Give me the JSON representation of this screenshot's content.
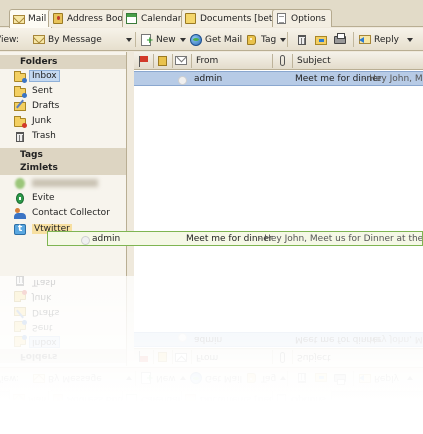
{
  "tabs": [
    {
      "label": "Mail",
      "icon": "envelope-icon",
      "active": true
    },
    {
      "label": "Address Book",
      "icon": "address-book-icon"
    },
    {
      "label": "Calendar",
      "icon": "calendar-icon"
    },
    {
      "label": "Documents [beta]",
      "icon": "documents-icon"
    },
    {
      "label": "Options",
      "icon": "options-icon"
    }
  ],
  "toolbar": {
    "view_label": "View:",
    "view_value": "By Message",
    "new_label": "New",
    "get_mail_label": "Get Mail",
    "tag_label": "Tag",
    "reply_label": "Reply"
  },
  "tree": {
    "folders_header": "Folders",
    "folders": [
      {
        "label": "Inbox",
        "icon": "inbox-icon",
        "selected": true
      },
      {
        "label": "Sent",
        "icon": "sent-icon"
      },
      {
        "label": "Drafts",
        "icon": "drafts-icon"
      },
      {
        "label": "Junk",
        "icon": "junk-icon"
      },
      {
        "label": "Trash",
        "icon": "trash-icon"
      }
    ],
    "tags_header": "Tags",
    "zimlets_header": "Zimlets",
    "zimlets": [
      {
        "label": "",
        "icon": "blurred-zimlet-icon"
      },
      {
        "label": "Evite",
        "icon": "evite-icon"
      },
      {
        "label": "Contact Collector",
        "icon": "contact-collector-icon"
      },
      {
        "label": "Vtwitter",
        "icon": "vtwitter-icon",
        "drop_target": true
      }
    ]
  },
  "list": {
    "columns": {
      "from": "From",
      "subject": "Subject"
    },
    "rows": [
      {
        "from": "admin",
        "subject": "Meet me for dinner",
        "fragment": " - Hey John, Me"
      }
    ]
  },
  "drag_proxy": {
    "from": "admin",
    "subject": "Meet me for dinner",
    "fragment": " - Hey John, Meet us for Dinner at the Balg"
  },
  "colors": {
    "selected_row": "#b7cbe6",
    "drag_border": "#7fb552",
    "chrome": "#efe9dc"
  }
}
